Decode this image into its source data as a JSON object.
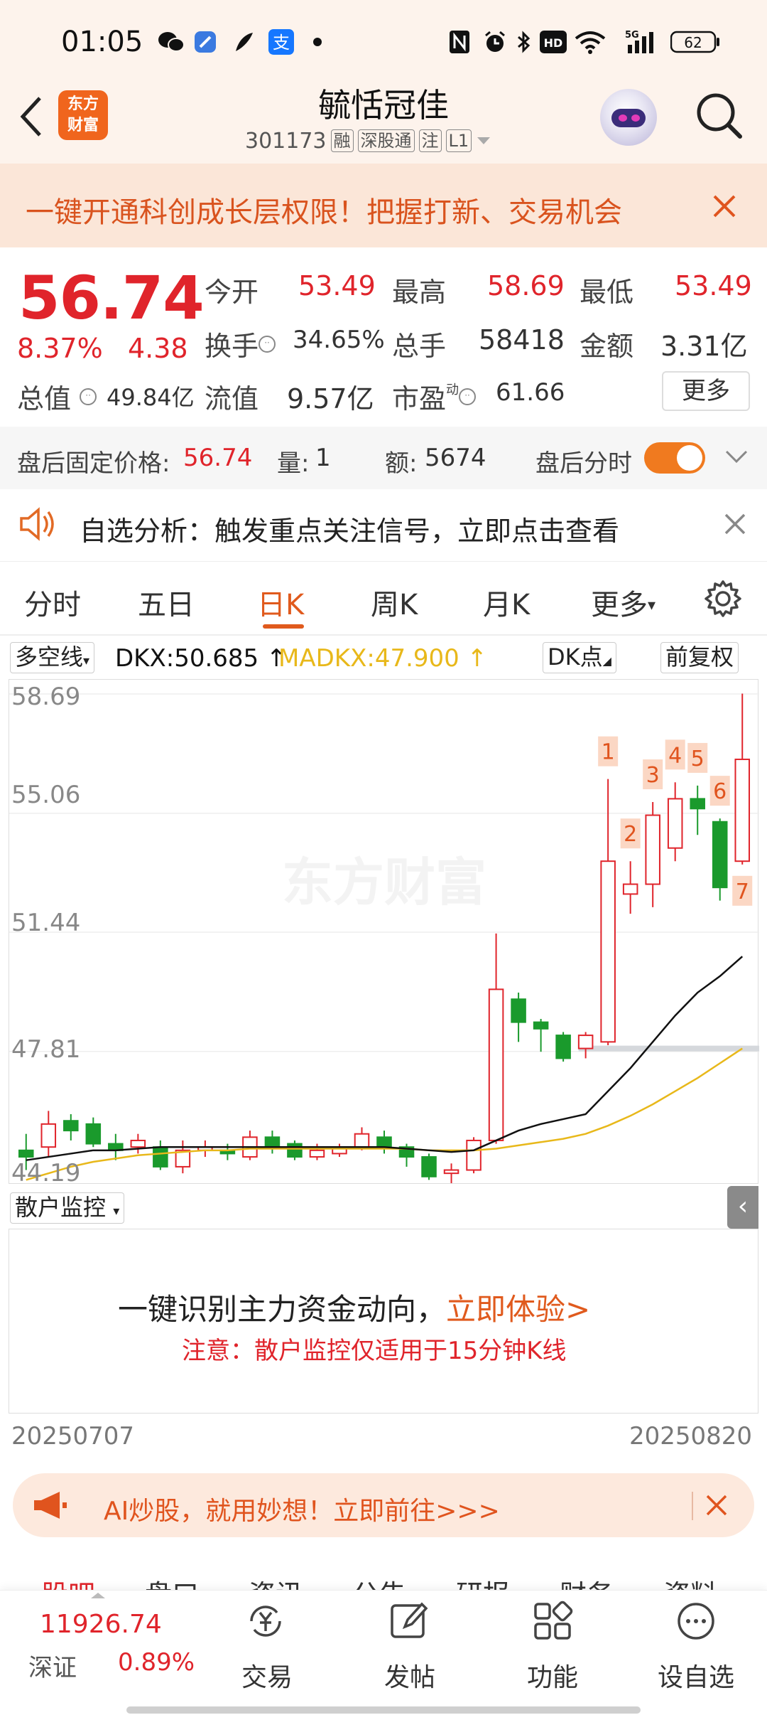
{
  "status_bar": {
    "time": "01:05",
    "battery": "62"
  },
  "header": {
    "logo_text": "东方\n财富",
    "stock_name": "毓恬冠佳",
    "stock_code": "301173",
    "tags": [
      "融",
      "深股通",
      "注",
      "L1"
    ]
  },
  "banner": {
    "text": "一键开通科创成长层权限！把握打新、交易机会"
  },
  "quote": {
    "price": "56.74",
    "change_pct": "8.37%",
    "change": "4.38",
    "open_label": "今开",
    "open": "53.49",
    "high_label": "最高",
    "high": "58.69",
    "low_label": "最低",
    "low": "53.49",
    "turnover_label": "换手",
    "turnover": "34.65%",
    "volume_label": "总手",
    "volume": "58418",
    "amount_label": "金额",
    "amount": "3.31亿",
    "mktcap_label": "总值",
    "mktcap": "49.84亿",
    "float_label": "流值",
    "float": "9.57亿",
    "pe_label": "市盈",
    "pe_sup": "动",
    "pe": "61.66",
    "more": "更多"
  },
  "after_hours": {
    "price_label": "盘后固定价格:",
    "price": "56.74",
    "vol_label": "量:",
    "vol": "1",
    "amt_label": "额:",
    "amt": "5674",
    "toggle_label": "盘后分时",
    "toggle_on": true
  },
  "alert": {
    "text": "自选分析：触发重点关注信号，立即点击查看"
  },
  "tabs": [
    "分时",
    "五日",
    "日K",
    "周K",
    "月K",
    "更多"
  ],
  "active_tab": "日K",
  "indicator": {
    "select": "多空线",
    "dkx": "DKX:50.685",
    "madkx": "MADKX:47.900",
    "dk_point": "DK点",
    "fq": "前复权"
  },
  "colors": {
    "up": "#e0242b",
    "down": "#1a9a2c",
    "dkx": "#111111",
    "madkx": "#e8b81a",
    "accent": "#e05a1d"
  },
  "chart_data": {
    "type": "candlestick",
    "y_ticks": [
      "58.69",
      "55.06",
      "51.44",
      "47.81",
      "44.19"
    ],
    "ylim": [
      44.19,
      58.69
    ],
    "x_start": "20250707",
    "x_end": "20250820",
    "watermark": "东方财富",
    "candles": [
      {
        "o": 44.8,
        "c": 44.6,
        "h": 45.3,
        "l": 44.2
      },
      {
        "o": 44.9,
        "c": 45.6,
        "h": 46.0,
        "l": 44.6
      },
      {
        "o": 45.7,
        "c": 45.4,
        "h": 45.9,
        "l": 45.1
      },
      {
        "o": 45.6,
        "c": 45.0,
        "h": 45.8,
        "l": 44.9
      },
      {
        "o": 45.0,
        "c": 44.8,
        "h": 45.3,
        "l": 44.5
      },
      {
        "o": 44.9,
        "c": 45.1,
        "h": 45.3,
        "l": 44.7
      },
      {
        "o": 44.9,
        "c": 44.3,
        "h": 45.1,
        "l": 44.2
      },
      {
        "o": 44.3,
        "c": 44.8,
        "h": 45.1,
        "l": 44.1
      },
      {
        "o": 44.8,
        "c": 44.9,
        "h": 45.1,
        "l": 44.6
      },
      {
        "o": 44.8,
        "c": 44.7,
        "h": 45.0,
        "l": 44.5
      },
      {
        "o": 44.6,
        "c": 45.2,
        "h": 45.4,
        "l": 44.5
      },
      {
        "o": 45.2,
        "c": 44.9,
        "h": 45.4,
        "l": 44.7
      },
      {
        "o": 45.0,
        "c": 44.6,
        "h": 45.1,
        "l": 44.5
      },
      {
        "o": 44.6,
        "c": 44.8,
        "h": 45.0,
        "l": 44.5
      },
      {
        "o": 44.7,
        "c": 44.9,
        "h": 45.0,
        "l": 44.6
      },
      {
        "o": 44.9,
        "c": 45.3,
        "h": 45.5,
        "l": 44.8
      },
      {
        "o": 45.2,
        "c": 44.9,
        "h": 45.4,
        "l": 44.7
      },
      {
        "o": 44.9,
        "c": 44.6,
        "h": 45.0,
        "l": 44.3
      },
      {
        "o": 44.6,
        "c": 44.0,
        "h": 44.7,
        "l": 43.9
      },
      {
        "o": 44.1,
        "c": 44.2,
        "h": 44.4,
        "l": 43.8
      },
      {
        "o": 44.2,
        "c": 45.1,
        "h": 45.2,
        "l": 44.1
      },
      {
        "o": 45.1,
        "c": 49.7,
        "h": 51.4,
        "l": 45.0
      },
      {
        "o": 49.4,
        "c": 48.7,
        "h": 49.6,
        "l": 48.1
      },
      {
        "o": 48.7,
        "c": 48.5,
        "h": 48.8,
        "l": 47.8
      },
      {
        "o": 48.3,
        "c": 47.6,
        "h": 48.4,
        "l": 47.5
      },
      {
        "o": 47.9,
        "c": 48.3,
        "h": 48.4,
        "l": 47.6
      },
      {
        "o": 48.1,
        "c": 53.6,
        "h": 56.1,
        "l": 48.0
      },
      {
        "o": 52.6,
        "c": 52.9,
        "h": 53.6,
        "l": 52.0
      },
      {
        "o": 52.9,
        "c": 55.0,
        "h": 55.4,
        "l": 52.2
      },
      {
        "o": 54.0,
        "c": 55.5,
        "h": 56.0,
        "l": 53.6
      },
      {
        "o": 55.5,
        "c": 55.2,
        "h": 55.9,
        "l": 54.4
      },
      {
        "o": 54.8,
        "c": 52.8,
        "h": 54.9,
        "l": 52.4
      },
      {
        "o": 53.6,
        "c": 56.7,
        "h": 58.7,
        "l": 53.5
      }
    ],
    "dk_points": [
      {
        "label": "1",
        "index": 26
      },
      {
        "label": "2",
        "index": 27
      },
      {
        "label": "3",
        "index": 28
      },
      {
        "label": "4",
        "index": 29
      },
      {
        "label": "5",
        "index": 30
      },
      {
        "label": "6",
        "index": 31
      },
      {
        "label": "7",
        "index": 32
      }
    ],
    "dkx": [
      44.5,
      44.6,
      44.7,
      44.8,
      44.8,
      44.85,
      44.9,
      44.9,
      44.9,
      44.9,
      44.9,
      44.9,
      44.9,
      44.9,
      44.9,
      44.9,
      44.9,
      44.85,
      44.8,
      44.75,
      44.8,
      45.1,
      45.4,
      45.6,
      45.75,
      45.9,
      46.6,
      47.3,
      48.1,
      48.9,
      49.6,
      50.1,
      50.7
    ],
    "madkx": [
      43.9,
      44.1,
      44.3,
      44.45,
      44.55,
      44.65,
      44.7,
      44.75,
      44.8,
      44.8,
      44.85,
      44.85,
      44.85,
      44.85,
      44.85,
      44.85,
      44.85,
      44.85,
      44.8,
      44.8,
      44.8,
      44.85,
      44.95,
      45.05,
      45.15,
      45.3,
      45.55,
      45.85,
      46.2,
      46.6,
      47.0,
      47.45,
      47.9
    ],
    "support_line": 47.9
  },
  "monitor": {
    "select": "散户监控",
    "main_text": "一键识别主力资金动向，",
    "link_text": "立即体验>",
    "note": "注意：散户监控仅适用于15分钟K线"
  },
  "ai_bar": {
    "text": "AI炒股，就用妙想！立即前往>>>"
  },
  "bottom_tabs": [
    "股吧",
    "盘口",
    "资讯",
    "公告",
    "研报",
    "财务",
    "资料"
  ],
  "bottom_nav": {
    "index_value": "11926.74",
    "index_name": "深证",
    "index_change": "0.89%",
    "items": [
      "交易",
      "发帖",
      "功能",
      "设自选"
    ]
  }
}
